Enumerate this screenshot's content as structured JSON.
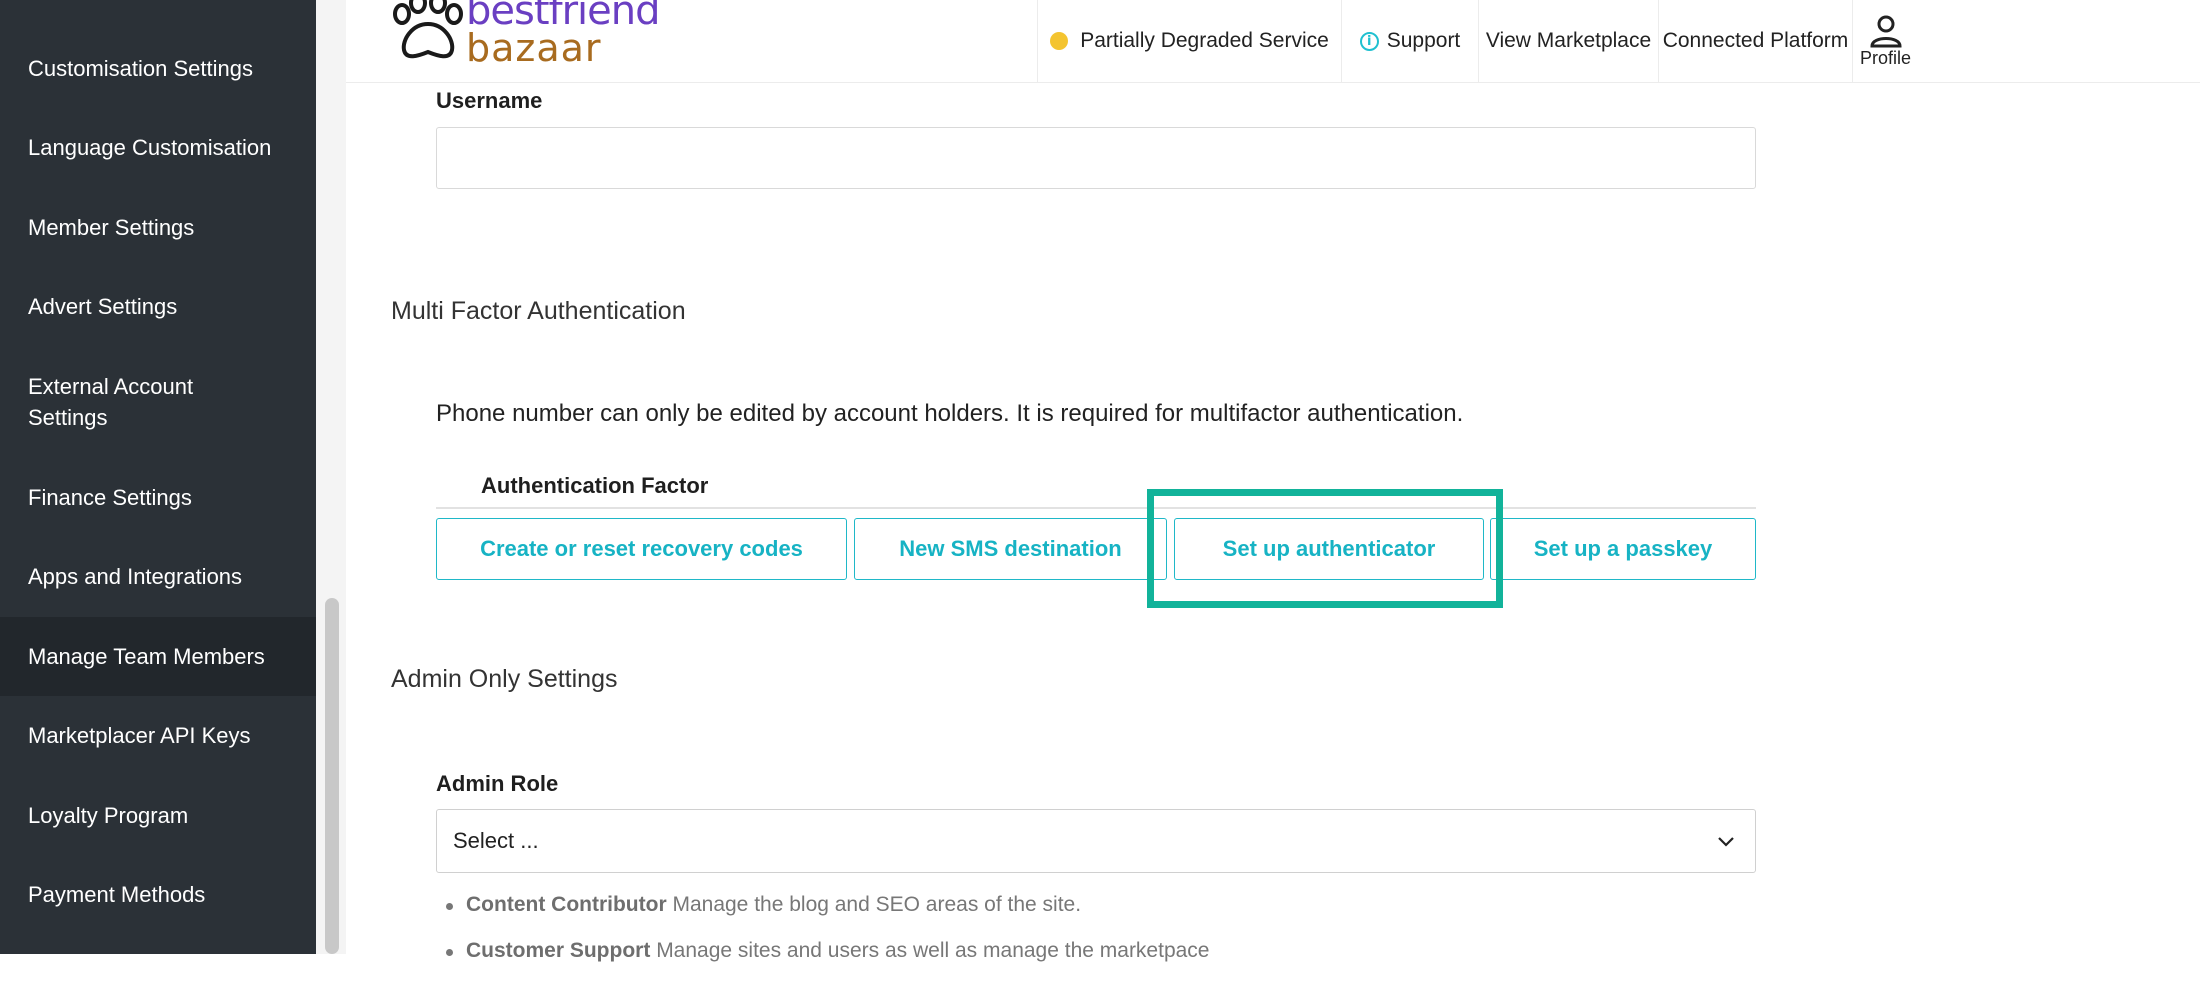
{
  "sidebar": {
    "partial_top_label": "",
    "items": [
      {
        "label": "Customisation Settings"
      },
      {
        "label": "Language Customisation"
      },
      {
        "label": "Member Settings"
      },
      {
        "label": "Advert Settings"
      },
      {
        "label": "External Account Settings"
      },
      {
        "label": "Finance Settings"
      },
      {
        "label": "Apps and Integrations"
      },
      {
        "label": "Manage Team Members",
        "active": true
      },
      {
        "label": "Marketplacer API Keys"
      },
      {
        "label": "Loyalty Program"
      },
      {
        "label": "Payment Methods"
      }
    ]
  },
  "header": {
    "logo": {
      "line1": "bestfriend",
      "line2": "bazaar"
    },
    "status": {
      "label": "Partially Degraded Service",
      "color": "#f4c430"
    },
    "support": {
      "label": "Support",
      "icon": "info-icon"
    },
    "view_marketplace": "View Marketplace",
    "connected_platform": "Connected Platform",
    "profile": {
      "label": "Profile",
      "icon": "user-icon"
    }
  },
  "form": {
    "username": {
      "label": "Username",
      "value": ""
    },
    "mfa": {
      "title": "Multi Factor Authentication",
      "note": "Phone number can only be edited by account holders. It is required for multifactor authentication.",
      "table_header": "Authentication Factor",
      "buttons": {
        "recovery_codes": "Create or reset recovery codes",
        "new_sms": "New SMS destination",
        "authenticator": "Set up authenticator",
        "passkey": "Set up a passkey"
      }
    },
    "admin": {
      "title": "Admin Only Settings",
      "role_label": "Admin Role",
      "role_select": "Select ...",
      "roles": [
        {
          "name": "Content Contributor",
          "description": "Manage the blog and SEO areas of the site."
        },
        {
          "name": "Customer Support",
          "description": "Manage sites and users as well as manage the marketpace"
        }
      ]
    }
  },
  "colors": {
    "accent": "#17b3c4",
    "highlight": "#12b39a",
    "sidebar_bg": "#2b3137"
  }
}
